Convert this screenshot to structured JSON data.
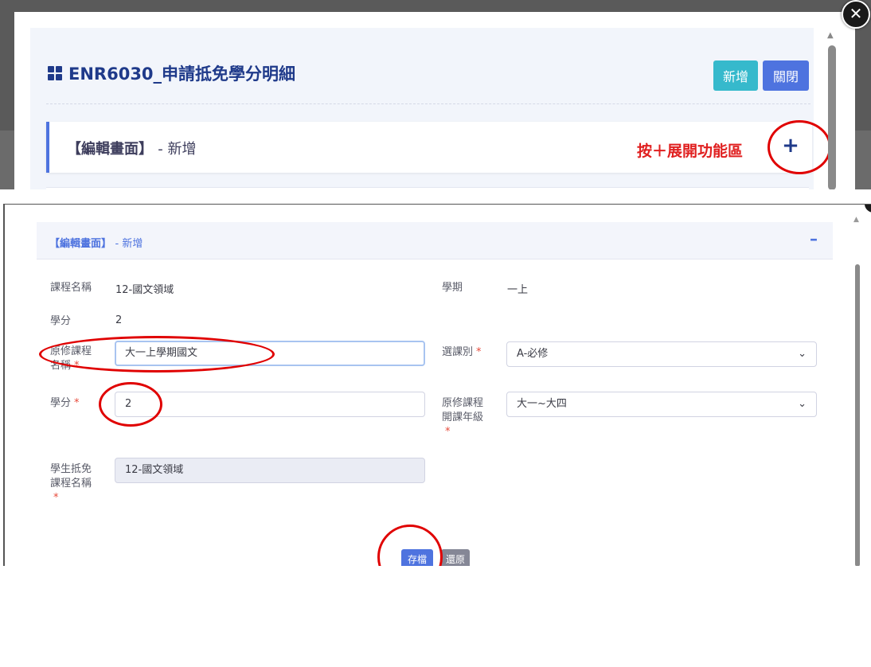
{
  "top": {
    "title": "ENR6030_申請抵免學分明細",
    "title_icon": "grid-icon",
    "buttons": {
      "new": "新增",
      "close": "關閉"
    },
    "card_title_main": "【編輯畫面】",
    "card_title_dash": "- 新增",
    "hint": "按＋展開功能區",
    "expand_symbol": "+",
    "colors": {
      "accent": "#4e73df",
      "info": "#36b9cc",
      "annotation": "#e00000",
      "title": "#1f3a8a"
    }
  },
  "form": {
    "header_main": "【編輯畫面】",
    "header_dash": "- 新增",
    "collapse_symbol": "–",
    "course_name_label": "課程名稱",
    "course_name_value": "12-國文領域",
    "semester_label": "學期",
    "semester_value": "一上",
    "credit_label": "學分",
    "credit_value": "2",
    "orig_course_label": "原修課程名稱",
    "orig_course_value": "大一上學期國文",
    "elective_label": "選課別",
    "elective_value": "A-必修",
    "orig_credit_label": "學分",
    "orig_credit_value": "2",
    "orig_grade_label": "原修課程開課年級",
    "orig_grade_value": "大一~大四",
    "student_course_label": "學生抵免課程名稱",
    "student_course_value": "12-國文領域",
    "required_mark": "*",
    "save_label": "存檔",
    "reset_label": "還原"
  }
}
